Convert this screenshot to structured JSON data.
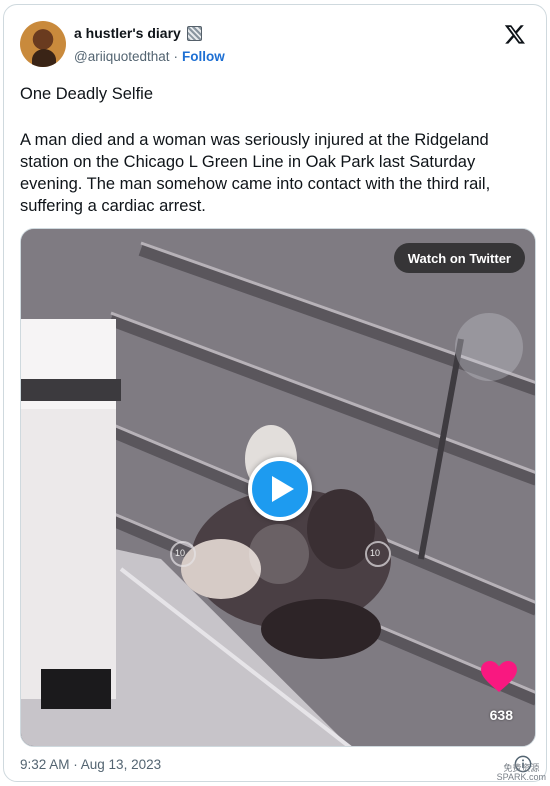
{
  "author": {
    "display_name": "a hustler's diary",
    "handle": "@ariiquotedthat",
    "separator": "·",
    "follow_label": "Follow"
  },
  "tweet": {
    "title": "One Deadly Selfie",
    "body": "A man died and a woman was seriously injured at the Ridgeland station on the Chicago L Green Line in Oak Park last Saturday evening.  The man somehow came into contact with the third rail, suffering a cardiac arrest.",
    "timestamp": "9:32 AM · Aug 13, 2023"
  },
  "media": {
    "watch_label": "Watch on Twitter",
    "like_count": "638",
    "rewind_label": "10",
    "forward_label": "10"
  },
  "icons": {
    "logo": "x-logo-icon",
    "play": "play-icon",
    "heart": "heart-icon",
    "info": "info-icon",
    "name_emoji": "badge-emoji-icon"
  },
  "colors": {
    "play_button": "#1d9bf0",
    "follow_link": "#1d6fd3",
    "heart": "#f91880",
    "secondary_text": "#536471"
  },
  "watermark": {
    "line1": "免费资源",
    "line2": "SPARK.com"
  }
}
